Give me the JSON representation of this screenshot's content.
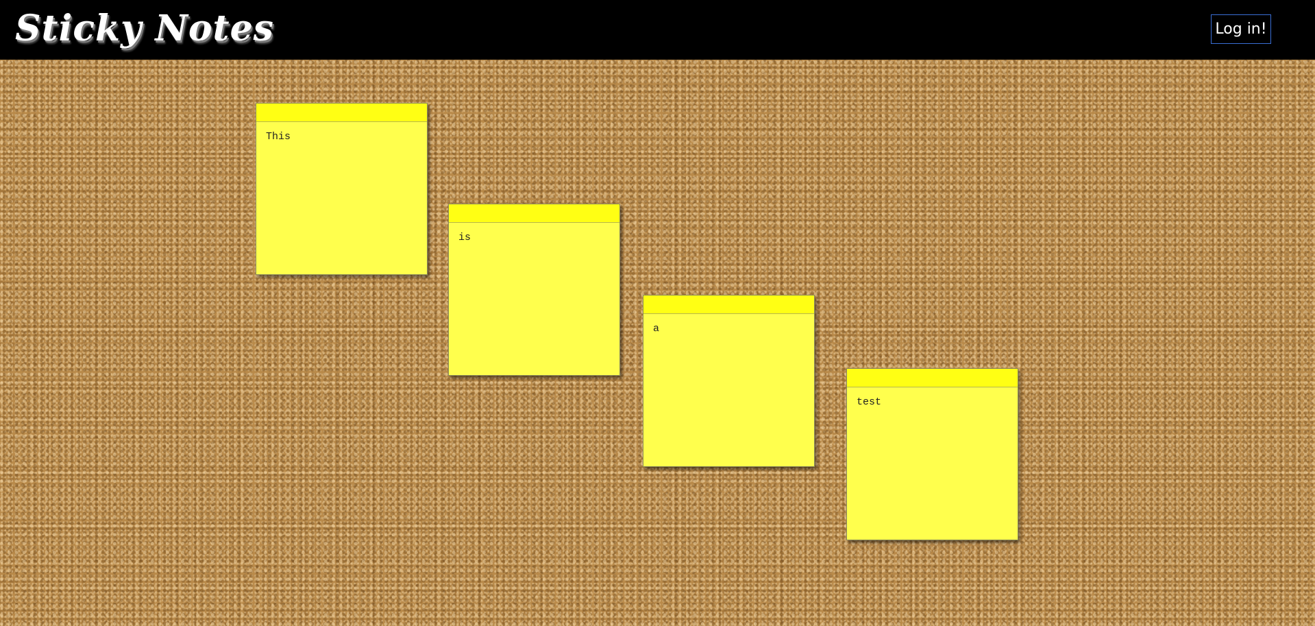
{
  "app": {
    "title": "Sticky Notes"
  },
  "header": {
    "login_label": "Log in!"
  },
  "notes": [
    {
      "text": "This"
    },
    {
      "text": "is"
    },
    {
      "text": "a"
    },
    {
      "text": "test"
    }
  ],
  "colors": {
    "header_bg": "#000000",
    "note_body": "#ffff4d",
    "note_bar": "#ffff14",
    "login_border": "#3a6fd6",
    "corkboard": "#b98a4a"
  }
}
